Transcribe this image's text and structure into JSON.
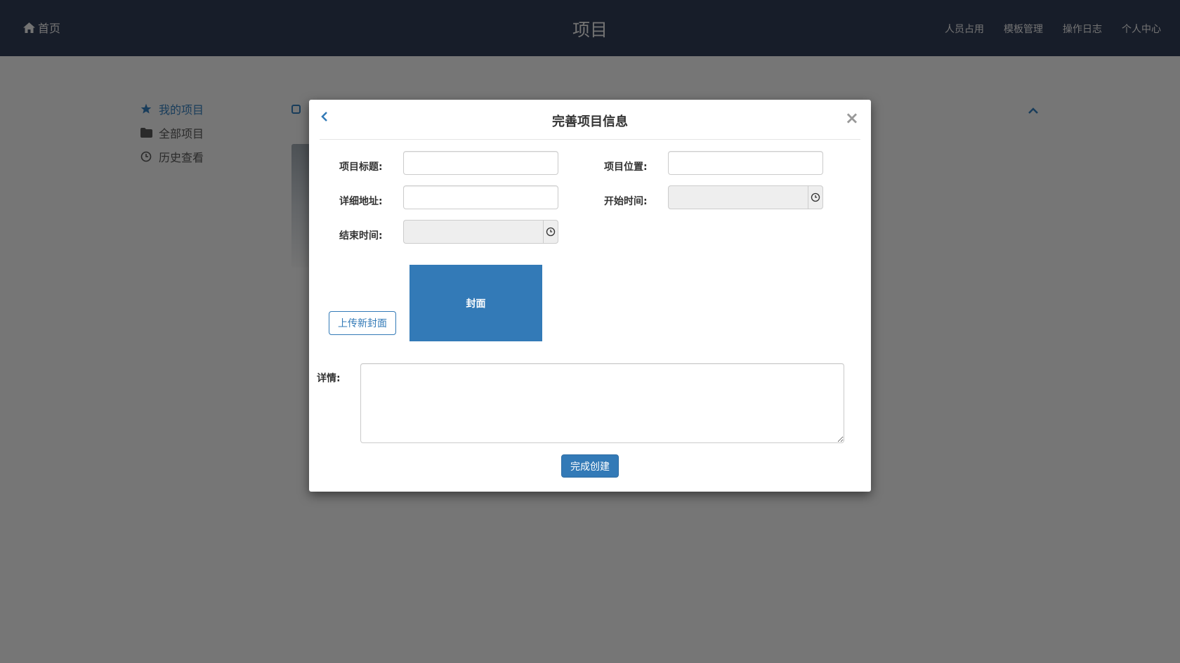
{
  "colors": {
    "navbar_bg": "#2f3a52",
    "primary": "#337ab7",
    "overlay": "rgba(0,0,0,0.5)"
  },
  "navbar": {
    "home_label": "首页",
    "title": "项目",
    "links": [
      "人员占用",
      "模板管理",
      "操作日志",
      "个人中心"
    ]
  },
  "sidebar": {
    "items": [
      {
        "label": "我的项目",
        "icon": "star-icon",
        "active": true
      },
      {
        "label": "全部项目",
        "icon": "folder-icon",
        "active": false
      },
      {
        "label": "历史查看",
        "icon": "clock-icon",
        "active": false
      }
    ]
  },
  "modal": {
    "title": "完善项目信息",
    "close_symbol": "×",
    "fields": {
      "project_title": {
        "label": "项目标题:",
        "value": ""
      },
      "project_location": {
        "label": "项目位置:",
        "value": ""
      },
      "detail_address": {
        "label": "详细地址:",
        "value": ""
      },
      "start_time": {
        "label": "开始时间:",
        "value": ""
      },
      "end_time": {
        "label": "结束时间:",
        "value": ""
      }
    },
    "upload_cover_label": "上传新封面",
    "cover_label": "封面",
    "details_label": "详情:",
    "details_value": "",
    "submit_label": "完成创建"
  }
}
